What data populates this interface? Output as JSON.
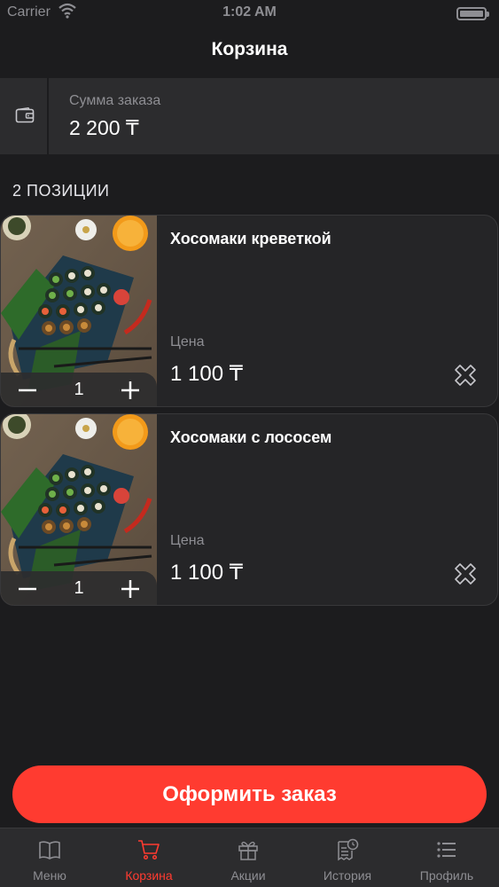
{
  "status_bar": {
    "carrier": "Carrier",
    "time": "1:02 AM"
  },
  "header": {
    "title": "Корзина"
  },
  "summary": {
    "label": "Сумма заказа",
    "value": "2 200 ₸",
    "icon": "wallet-icon"
  },
  "cart": {
    "count_label": "2 ПОЗИЦИИ",
    "items": [
      {
        "name": "Хосомаки креветкой",
        "price_label": "Цена",
        "price": "1 100 ₸",
        "quantity": "1"
      },
      {
        "name": "Хосомаки с лососем",
        "price_label": "Цена",
        "price": "1 100 ₸",
        "quantity": "1"
      }
    ]
  },
  "checkout": {
    "label": "Оформить заказ"
  },
  "tabbar": {
    "tabs": [
      {
        "label": "Меню",
        "icon": "book-icon"
      },
      {
        "label": "Корзина",
        "icon": "cart-icon",
        "active": true
      },
      {
        "label": "Акции",
        "icon": "gift-icon"
      },
      {
        "label": "История",
        "icon": "receipt-clock-icon"
      },
      {
        "label": "Профиль",
        "icon": "list-icon"
      }
    ]
  },
  "colors": {
    "accent": "#ff3b30",
    "background": "#1c1c1e",
    "card": "#252527",
    "muted": "#8e8e93"
  }
}
